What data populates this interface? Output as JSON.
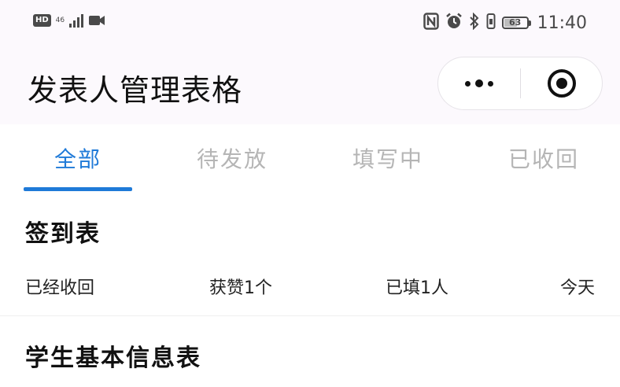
{
  "status_bar": {
    "hd_badge": "HD",
    "network_type": "46",
    "network_sub": "4G",
    "battery_level": "63",
    "time": "11:40",
    "icons": [
      "nfc-icon",
      "alarm-icon",
      "bluetooth-icon",
      "vibrate-icon"
    ]
  },
  "nav": {
    "title": "发表人管理表格"
  },
  "tabs": [
    {
      "label": "全部",
      "active": true
    },
    {
      "label": "待发放",
      "active": false
    },
    {
      "label": "填写中",
      "active": false
    },
    {
      "label": "已收回",
      "active": false
    }
  ],
  "forms": [
    {
      "title": "签到表",
      "status": "已经收回",
      "likes": "获赞1个",
      "filled": "已填1人",
      "date": "今天"
    },
    {
      "title": "学生基本信息表"
    }
  ],
  "colors": {
    "accent": "#1f7ad8",
    "inactive_tab": "#b5b5b5",
    "page_bg": "#fcf9fd"
  }
}
